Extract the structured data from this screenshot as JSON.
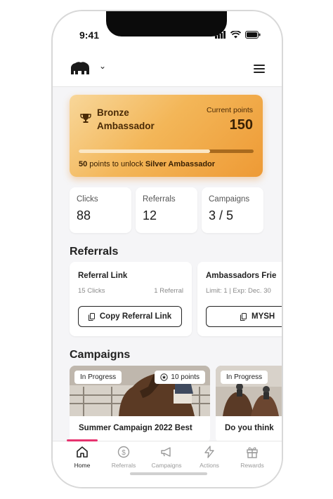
{
  "status_bar": {
    "time": "9:41"
  },
  "header": {
    "logo_icon": "bear-logo-icon",
    "menu_icon": "hamburger-menu-icon"
  },
  "tier": {
    "name": "Bronze Ambassador",
    "points_label": "Current points",
    "points_value": "150",
    "progress": 0.75,
    "unlock_points": "50",
    "unlock_middle": " points to unlock ",
    "unlock_target": "Silver Ambassador"
  },
  "stats": [
    {
      "label": "Clicks",
      "value": "88"
    },
    {
      "label": "Referrals",
      "value": "12"
    },
    {
      "label": "Campaigns",
      "value": "3 / 5"
    }
  ],
  "referrals": {
    "title": "Referrals",
    "cards": [
      {
        "title": "Referral Link",
        "clicks": "15 Clicks",
        "referrals": "1 Referral",
        "button": "Copy Referral Link"
      },
      {
        "title": "Ambassadors Frie",
        "meta": "Limit: 1 | Exp: Dec. 30",
        "button": "MYSH"
      }
    ]
  },
  "campaigns": {
    "title": "Campaigns",
    "cards": [
      {
        "status": "In Progress",
        "points": "10 points",
        "title": "Summer Campaign 2022  Best"
      },
      {
        "status": "In Progress",
        "title": "Do you think"
      }
    ]
  },
  "tabs": [
    {
      "label": "Home",
      "icon": "home-icon"
    },
    {
      "label": "Referrals",
      "icon": "dollar-icon"
    },
    {
      "label": "Campaigns",
      "icon": "megaphone-icon"
    },
    {
      "label": "Actions",
      "icon": "lightning-icon"
    },
    {
      "label": "Rewards",
      "icon": "gift-icon"
    }
  ],
  "colors": {
    "accent": "#e6336f",
    "tier_gradient_start": "#f8d79a",
    "tier_gradient_end": "#ee9a35"
  }
}
